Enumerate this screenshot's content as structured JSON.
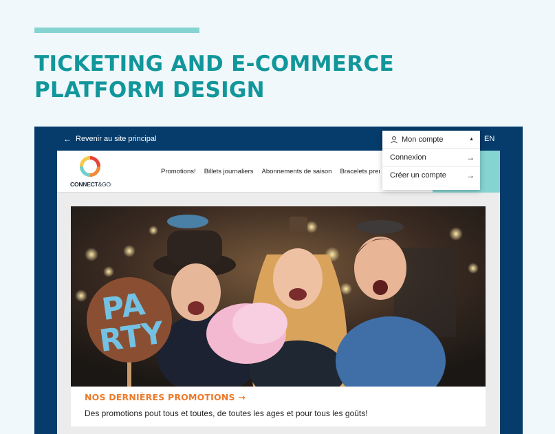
{
  "headline": {
    "line1": "TICKETING AND E-COMMERCE",
    "line2": "PLATFORM DESIGN"
  },
  "topbar": {
    "back_label": "Revenir au site principal",
    "language": "EN"
  },
  "logo": {
    "brand_bold": "CONNECT",
    "brand_amp": "&GO"
  },
  "nav": {
    "items": [
      "Promotions!",
      "Billets journaliers",
      "Abonnements de saison",
      "Bracelets premium"
    ]
  },
  "account_menu": {
    "label": "Mon compte",
    "expanded": true,
    "items": [
      {
        "label": "Connexion"
      },
      {
        "label": "Créer un compte"
      }
    ]
  },
  "promo": {
    "title": "NOS DERNIÈRES PROMOTIONS →",
    "description": "Des promotions pout tous et toutes, de toutes les ages et pour tous les goûts!",
    "image_sign_text": "PARTY"
  },
  "colors": {
    "page_bg": "#f1f8fb",
    "headline": "#11979b",
    "accent_line": "#86d4d2",
    "browser_frame": "#063c6b",
    "promo_title": "#ec7a2a"
  },
  "icons": {
    "back": "arrow-left-icon",
    "user": "user-icon",
    "caret": "caret-up-icon",
    "item_arrow": "arrow-right-icon"
  }
}
